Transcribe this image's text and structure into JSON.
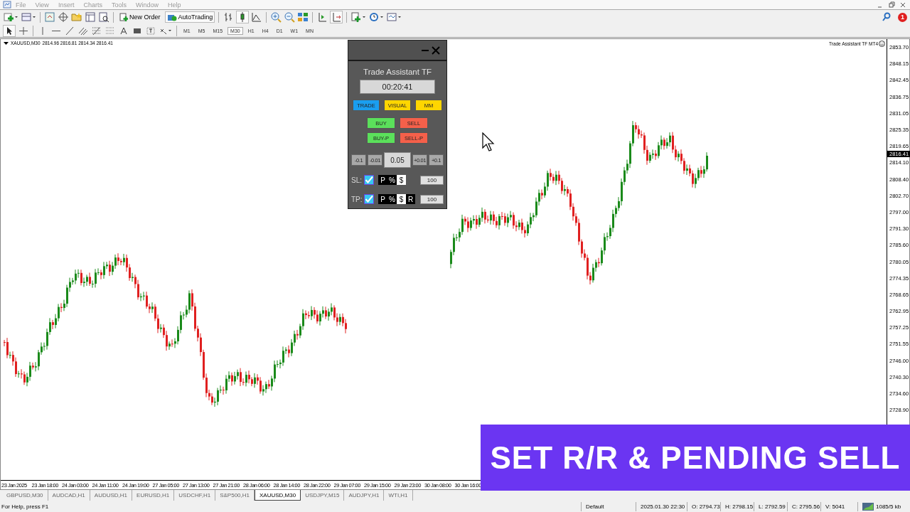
{
  "menu": [
    "File",
    "View",
    "Insert",
    "Charts",
    "Tools",
    "Window",
    "Help"
  ],
  "toolbar": {
    "new_order": "New Order",
    "auto_trading": "AutoTrading",
    "timeframes": [
      {
        "label": "M1",
        "selected": false
      },
      {
        "label": "M5",
        "selected": false
      },
      {
        "label": "M15",
        "selected": false
      },
      {
        "label": "M30",
        "selected": true
      },
      {
        "label": "H1",
        "selected": false
      },
      {
        "label": "H4",
        "selected": false
      },
      {
        "label": "D1",
        "selected": false
      },
      {
        "label": "W1",
        "selected": false
      },
      {
        "label": "MN",
        "selected": false
      }
    ]
  },
  "notification_count": "1",
  "chart": {
    "symbol": "XAUUSD,M30",
    "ohlc": "2814.96 2816.81 2814.34 2816.41",
    "indicator_label": "Trade Assistant TF MT4",
    "price_labels": [
      "2853.70",
      "2848.15",
      "2842.45",
      "2836.75",
      "2831.05",
      "2825.35",
      "2819.65",
      "2814.10",
      "2808.40",
      "2802.70",
      "2797.00",
      "2791.30",
      "2785.60",
      "2780.05",
      "2774.35",
      "2768.65",
      "2762.95",
      "2757.25",
      "2751.55",
      "2746.00",
      "2740.30",
      "2734.60",
      "2728.90"
    ],
    "current_price": "2816.41",
    "time_labels": [
      "23 Jan 2025",
      "23 Jan 18:00",
      "24 Jan 03:00",
      "24 Jan 11:00",
      "24 Jan 19:00",
      "27 Jan 05:00",
      "27 Jan 13:00",
      "27 Jan 21:00",
      "28 Jan 06:00",
      "28 Jan 14:00",
      "28 Jan 22:00",
      "29 Jan 07:00",
      "29 Jan 15:00",
      "29 Jan 23:00",
      "30 Jan 08:00",
      "30 Jan 16:00"
    ]
  },
  "panel": {
    "title": "Trade Assistant TF",
    "timer": "00:20:41",
    "modes": [
      {
        "label": "TRADE",
        "selected": true
      },
      {
        "label": "VISUAL",
        "selected": false
      },
      {
        "label": "MM",
        "selected": false
      }
    ],
    "orders": [
      {
        "label": "BUY",
        "kind": "buy"
      },
      {
        "label": "SELL",
        "kind": "sell"
      },
      {
        "label": "BUY-P",
        "kind": "buy"
      },
      {
        "label": "SELL-P",
        "kind": "sell"
      }
    ],
    "lot_minus": [
      "-0.1",
      "-0.01"
    ],
    "lot": "0.05",
    "lot_plus": [
      "+0.01",
      "+0.1"
    ],
    "stops": [
      {
        "label": "SL:",
        "checked": true,
        "units": [
          {
            "label": "P",
            "selected": false
          },
          {
            "label": "%",
            "selected": false
          },
          {
            "label": "$",
            "selected": true
          }
        ],
        "value": "100"
      },
      {
        "label": "TP:",
        "checked": true,
        "units": [
          {
            "label": "P",
            "selected": false
          },
          {
            "label": "%",
            "selected": false
          },
          {
            "label": "$",
            "selected": true
          },
          {
            "label": "R",
            "selected": false
          }
        ],
        "value": "100"
      }
    ]
  },
  "banner": "SET R/R & PENDING SELL",
  "tabs": [
    {
      "label": "GBPUSD,M30",
      "selected": false
    },
    {
      "label": "AUDCAD,H1",
      "selected": false
    },
    {
      "label": "AUDUSD,H1",
      "selected": false
    },
    {
      "label": "EURUSD,H1",
      "selected": false
    },
    {
      "label": "USDCHF,H1",
      "selected": false
    },
    {
      "label": "S&P500,H1",
      "selected": false
    },
    {
      "label": "XAUUSD,M30",
      "selected": true
    },
    {
      "label": "USDJPY,M15",
      "selected": false
    },
    {
      "label": "AUDJPY,H1",
      "selected": false
    },
    {
      "label": "WTI,H1",
      "selected": false
    }
  ],
  "status_bar": {
    "help": "For Help, press F1",
    "profile": "Default",
    "time": "2025.01.30 22:30",
    "open": "O: 2794.73",
    "high": "H: 2798.15",
    "low": "L: 2792.59",
    "close": "C: 2795.56",
    "volume": "V: 5041",
    "traffic": "1085/5 kb"
  }
}
